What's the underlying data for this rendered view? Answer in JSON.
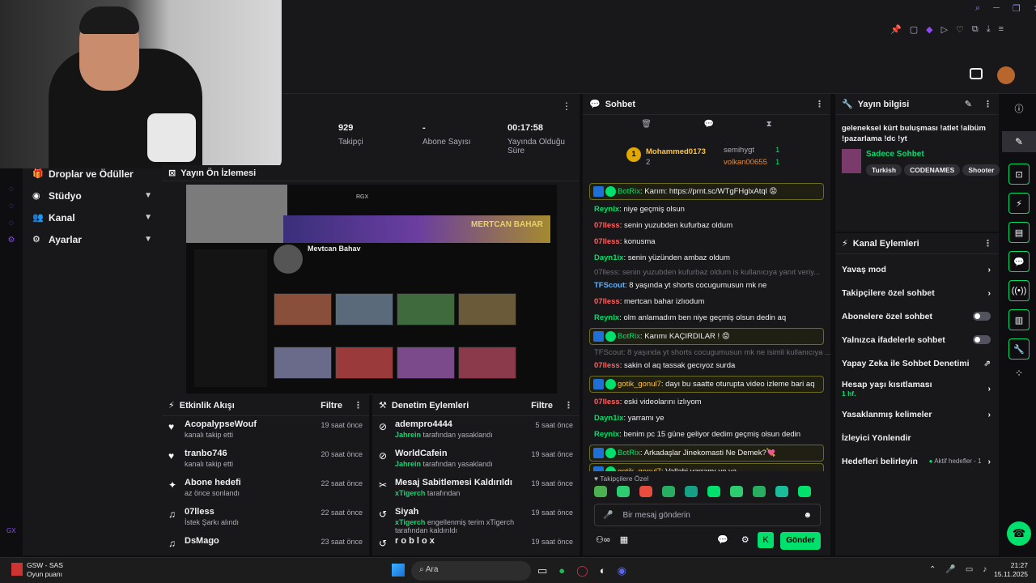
{
  "stats": [
    {
      "value": "929",
      "label": "Takipçi"
    },
    {
      "value": "-",
      "label": "Abone Sayısı"
    },
    {
      "value": "00:17:58",
      "label": "Yayında Olduğu Süre"
    }
  ],
  "sidebar": {
    "items": [
      {
        "label": "Droplar ve Ödüller",
        "icon": "gift-icon"
      },
      {
        "label": "Stüdyo",
        "icon": "studio-icon"
      },
      {
        "label": "Kanal",
        "icon": "channel-icon"
      },
      {
        "label": "Ayarlar",
        "icon": "gear-icon"
      }
    ],
    "footer": "GX"
  },
  "preview": {
    "title": "Yayın Ön İzlemesi",
    "channel_name": "Mevtcan Bahav",
    "overlay_text": "RGX",
    "banner_text": "MERTCAN BAHAR"
  },
  "activity": {
    "title": "Etkinlik Akışı",
    "filter": "Filtre",
    "rows": [
      {
        "name": "AcopalypseWouf",
        "sub": "kanalı takip etti",
        "time": "19 saat önce",
        "icon": "heart-icon"
      },
      {
        "name": "tranbo746",
        "sub": "kanalı takip etti",
        "time": "20 saat önce",
        "icon": "heart-icon"
      },
      {
        "name": "Abone hedefi",
        "sub": "az önce sonlandı",
        "time": "22 saat önce",
        "icon": "sparkle-icon"
      },
      {
        "name": "07lless",
        "sub": "İstek Şarkı alındı",
        "time": "22 saat önce",
        "icon": "music-icon"
      },
      {
        "name": "DsMago",
        "sub": "",
        "time": "23 saat önce",
        "icon": "music-icon"
      }
    ]
  },
  "moderation": {
    "title": "Denetim Eylemleri",
    "filter": "Filtre",
    "rows": [
      {
        "name": "adempro4444",
        "actor": "Jahrein",
        "sub": "tarafından yasaklandı",
        "time": "5 saat önce",
        "icon": "ban-icon"
      },
      {
        "name": "WorldCafein",
        "actor": "Jahrein",
        "sub": "tarafından yasaklandı",
        "time": "19 saat önce",
        "icon": "ban-icon"
      },
      {
        "name": "Mesaj Sabitlemesi Kaldırıldı",
        "actor": "xTigerch",
        "sub": "tarafından",
        "time": "19 saat önce",
        "icon": "unpin-icon"
      },
      {
        "name": "Siyah",
        "actor": "xTigerch",
        "sub": "engellenmiş terim xTigerch tarafından kaldırıldı",
        "time": "19 saat önce",
        "icon": "undo-icon"
      },
      {
        "name": "r o b l o x",
        "actor": "",
        "sub": "",
        "time": "19 saat önce",
        "icon": "undo-icon"
      }
    ]
  },
  "chat": {
    "title": "Sohbet",
    "leaderboard": {
      "first_name": "Mohammed0173",
      "first_count": "2",
      "second_name": "semihygt",
      "second_count": "1",
      "third_name": "volkan00655",
      "third_count": "1"
    },
    "messages": [
      {
        "user": "BotRix",
        "text": "Karım: https://prnt.sc/WTgFHglxAtql 😡",
        "color": "#00e06c",
        "highlight": true
      },
      {
        "user": "Reynlx",
        "text": "niye geçmiş olsun",
        "color": "#00e06c",
        "highlight": false
      },
      {
        "user": "07lless",
        "text": "senin yuzubden kufurbaz oldum",
        "color": "#ff5f5f",
        "highlight": false
      },
      {
        "user": "07lless",
        "text": "konusma",
        "color": "#ff5f5f",
        "highlight": false
      },
      {
        "user": "Dayn1ix",
        "text": "senin yüzünden ambaz oldum",
        "color": "#00e06c",
        "highlight": false
      },
      {
        "user": "TFScout",
        "text": "8 yaşında yt shorts cocugumusun mk ne",
        "color": "#5ab4ff",
        "highlight": false,
        "reply": "07lless: senin yuzubden kufurbaz oldum is kullanıcıya yanıt veriy..."
      },
      {
        "user": "07lless",
        "text": "mertcan bahar izlıodum",
        "color": "#ff5f5f",
        "highlight": false
      },
      {
        "user": "Reynlx",
        "text": "olm anlamadım ben niye geçmiş olsun dedin aq",
        "color": "#00e06c",
        "highlight": false
      },
      {
        "user": "BotRix",
        "text": "Karımı KAÇIRDILAR ! 😡",
        "color": "#00e06c",
        "highlight": true
      },
      {
        "user": "07lless",
        "text": "sakin ol aq tassak gecıyoz surda",
        "color": "#ff5f5f",
        "highlight": false,
        "reply": "TFScout: 8 yaşında yt shorts cocugumusun mk ne isimli kullanıcıya ..."
      },
      {
        "user": "gotik_gonul7",
        "text": "dayı bu saatte oturupta video izleme bari aq",
        "color": "#ffc53d",
        "highlight": true
      },
      {
        "user": "07lless",
        "text": "eski videolarını izlıyom",
        "color": "#ff5f5f",
        "highlight": false
      },
      {
        "user": "Dayn1ix",
        "text": "yarramı ye",
        "color": "#00e06c",
        "highlight": false
      },
      {
        "user": "Reynlx",
        "text": "benim pc 15 güne geliyor dedim geçmiş olsun dedin",
        "color": "#00e06c",
        "highlight": false
      },
      {
        "user": "BotRix",
        "text": "Arkadaşlar Jinekomasti Ne Demek?💘",
        "color": "#00e06c",
        "highlight": true
      },
      {
        "user": "gotik_gonul7",
        "text": "Vallahi yarramı ye ya",
        "color": "#ffc53d",
        "highlight": true
      }
    ],
    "emote_label": "Takipçilere Özel",
    "input_placeholder": "Bir mesaj gönderin",
    "send_label": "Gönder"
  },
  "stream_info": {
    "title": "Yayın bilgisi",
    "description": "geleneksel kürt buluşması !atlet !albüm !pazarlama !dc !yt",
    "category": "Sadece Sohbet",
    "tags": [
      "Turkish",
      "CODENAMES",
      "Shooter"
    ]
  },
  "channel_actions": {
    "title": "Kanal Eylemleri",
    "items": [
      {
        "label": "Yavaş mod",
        "control": "chevron"
      },
      {
        "label": "Takipçilere özel sohbet",
        "control": "chevron"
      },
      {
        "label": "Abonelere özel sohbet",
        "control": "toggle"
      },
      {
        "label": "Yalnızca ifadelerle sohbet",
        "control": "toggle"
      },
      {
        "label": "Yapay Zeka ile Sohbet Denetimi",
        "control": "external"
      },
      {
        "label": "Hesap yaşı kısıtlaması",
        "sub": "1 hf.",
        "control": "chevron"
      },
      {
        "label": "Yasaklanmış kelimeler",
        "control": "chevron"
      },
      {
        "label": "İzleyici Yönlendir",
        "control": "none"
      },
      {
        "label": "Hedefleri belirleyin",
        "extra": "Aktif hedefler - 1",
        "control": "chevron"
      }
    ]
  },
  "taskbar": {
    "game_title": "GSW - SAS",
    "game_sub": "Oyun puanı",
    "search": "Ara",
    "time": "21:27",
    "date": "15.11.2025"
  },
  "colors": {
    "accent": "#00e06c",
    "bg": "#0e0e10",
    "panel": "#18181b"
  }
}
